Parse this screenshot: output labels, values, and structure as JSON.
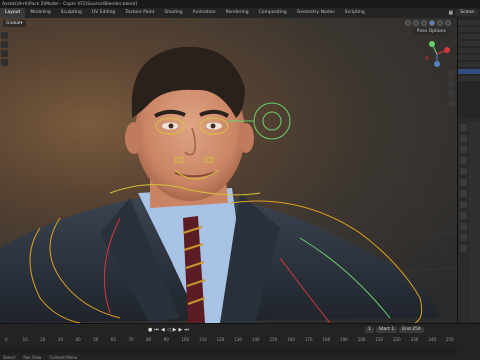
{
  "window": {
    "title": "Assets\\Arm\\Pack 2\\Model - Copie VF2\\Source\\Blender.blend]"
  },
  "workspaces": [
    {
      "label": "Layout",
      "active": true
    },
    {
      "label": "Modeling"
    },
    {
      "label": "Sculpting"
    },
    {
      "label": "UV Editing"
    },
    {
      "label": "Texture Paint"
    },
    {
      "label": "Shading"
    },
    {
      "label": "Animation"
    },
    {
      "label": "Rendering"
    },
    {
      "label": "Compositing"
    },
    {
      "label": "Geometry Nodes"
    },
    {
      "label": "Scripting"
    }
  ],
  "scene": {
    "label": "Scene"
  },
  "viewport": {
    "orientation": "Global",
    "pose_options": "Pose Options",
    "accent": "#5680c2"
  },
  "timeline": {
    "current_frame": "1",
    "start_label": "Start",
    "start_value": "1",
    "end_label": "End",
    "end_value": "250",
    "ruler_ticks": [
      "0",
      "10",
      "20",
      "30",
      "40",
      "50",
      "60",
      "70",
      "80",
      "90",
      "100",
      "110",
      "120",
      "130",
      "140",
      "150",
      "160",
      "170",
      "180",
      "190",
      "200",
      "210",
      "220",
      "230",
      "240",
      "250"
    ]
  },
  "statusbar": {
    "items": [
      "Select",
      "Pan View",
      "Context Menu"
    ]
  }
}
